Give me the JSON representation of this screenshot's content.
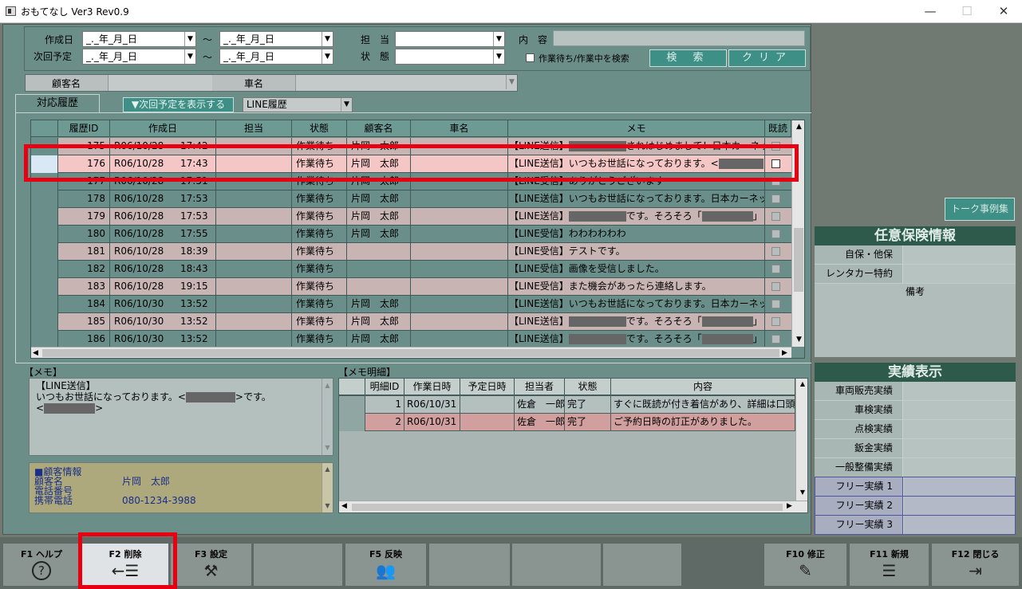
{
  "window": {
    "title": "おもてなし Ver3 Rev0.9",
    "min": "—",
    "max": "☐",
    "close": "✕"
  },
  "search": {
    "created_label": "作成日",
    "next_label": "次回予定",
    "date_placeholder": "_._年_月_日",
    "tilde": "〜",
    "staff_label": "担　当",
    "status_label": "状　態",
    "content_label": "内　容",
    "content_value": "",
    "waiting_checkbox_label": "作業待ち/作業中を検索",
    "search_button": "検 索",
    "clear_button": "クリア",
    "customer_label": "顧客名",
    "car_label": "車名"
  },
  "history": {
    "tab_label": "対応履歴",
    "show_next_button": "▼次回予定を表示する",
    "filter_value": "LINE履歴",
    "columns": [
      "履歴ID",
      "作成日",
      "担当",
      "状態",
      "顧客名",
      "車名",
      "メモ",
      "既読"
    ],
    "rows": [
      {
        "id": "175",
        "date": "R06/10/28",
        "time": "17:42",
        "staff": "",
        "status": "作業待ち",
        "customer": "片岡　太郎",
        "car": "",
        "memo_pre": "【LINE送信】",
        "redacted": true,
        "memo_post": "されはじめまして！日本カーネット株式",
        "style": "pink"
      },
      {
        "id": "176",
        "date": "R06/10/28",
        "time": "17:43",
        "staff": "",
        "status": "作業待ち",
        "customer": "片岡　太郎",
        "car": "",
        "memo_pre": "【LINE送信】いつもお世話になっております。<",
        "redacted": true,
        "memo_post": ">",
        "style": "selected"
      },
      {
        "id": "177",
        "date": "R06/10/28",
        "time": "17:51",
        "staff": "",
        "status": "作業待ち",
        "customer": "片岡　太郎",
        "car": "",
        "memo_pre": "【LINE受信】ありがとうございます",
        "redacted": false,
        "memo_post": "",
        "style": "teal"
      },
      {
        "id": "178",
        "date": "R06/10/28",
        "time": "17:53",
        "staff": "",
        "status": "作業待ち",
        "customer": "片岡　太郎",
        "car": "",
        "memo_pre": "【LINE送信】いつもお世話になっております。日本カーネッ",
        "redacted": false,
        "memo_post": "",
        "style": "teal"
      },
      {
        "id": "179",
        "date": "R06/10/28",
        "time": "17:53",
        "staff": "",
        "status": "作業待ち",
        "customer": "片岡　太郎",
        "car": "",
        "memo_pre": "【LINE送信】",
        "redacted": true,
        "memo_post": "です。そろそろ「",
        "redacted2": true,
        "memo_tail": "」",
        "style": "pink"
      },
      {
        "id": "180",
        "date": "R06/10/28",
        "time": "17:55",
        "staff": "",
        "status": "作業待ち",
        "customer": "片岡　太郎",
        "car": "",
        "memo_pre": "【LINE受信】わわわわわわ",
        "redacted": false,
        "memo_post": "",
        "style": "teal"
      },
      {
        "id": "181",
        "date": "R06/10/28",
        "time": "18:39",
        "staff": "",
        "status": "作業待ち",
        "customer": "",
        "car": "",
        "memo_pre": "【LINE受信】テストです。",
        "redacted": false,
        "memo_post": "",
        "style": "pink"
      },
      {
        "id": "182",
        "date": "R06/10/28",
        "time": "18:43",
        "staff": "",
        "status": "作業待ち",
        "customer": "",
        "car": "",
        "memo_pre": "【LINE受信】画像を受信しました。",
        "redacted": false,
        "memo_post": "",
        "style": "teal"
      },
      {
        "id": "183",
        "date": "R06/10/28",
        "time": "19:15",
        "staff": "",
        "status": "作業待ち",
        "customer": "",
        "car": "",
        "memo_pre": "【LINE受信】また機会があったら連絡します。",
        "redacted": false,
        "memo_post": "",
        "style": "pink"
      },
      {
        "id": "184",
        "date": "R06/10/30",
        "time": "13:52",
        "staff": "",
        "status": "作業待ち",
        "customer": "片岡　太郎",
        "car": "",
        "memo_pre": "【LINE送信】いつもお世話になっております。日本カーネッ",
        "redacted": false,
        "memo_post": "",
        "style": "teal"
      },
      {
        "id": "185",
        "date": "R06/10/30",
        "time": "13:52",
        "staff": "",
        "status": "作業待ち",
        "customer": "片岡　太郎",
        "car": "",
        "memo_pre": "【LINE送信】",
        "redacted": true,
        "memo_post": "です。そろそろ「",
        "redacted2": true,
        "memo_tail": "」",
        "style": "pink"
      },
      {
        "id": "186",
        "date": "R06/10/30",
        "time": "13:52",
        "staff": "",
        "status": "作業待ち",
        "customer": "片岡　太郎",
        "car": "",
        "memo_pre": "【LINE送信】",
        "redacted": true,
        "memo_post": "です。そろそろ「",
        "redacted2": true,
        "memo_tail": "」",
        "style": "teal"
      }
    ]
  },
  "memo": {
    "title": "【メモ】",
    "line1": "【LINE送信】",
    "line2_pre": "いつもお世話になっております。<",
    "line2_post": ">です。",
    "line3_pre": "<",
    "line3_post": ">"
  },
  "customer": {
    "heading": "■顧客情報",
    "name_label": "顧客名",
    "name_value": "片岡　太郎",
    "phone_label": "電話番号",
    "phone_value": "",
    "mobile_label": "携帯電話",
    "mobile_value": "080-1234-3988"
  },
  "detail": {
    "title": "【メモ明細】",
    "columns": [
      "明細ID",
      "作業日時",
      "予定日時",
      "担当者",
      "状態",
      "内容"
    ],
    "rows": [
      {
        "id": "1",
        "work_date": "R06/10/31",
        "plan_date": "",
        "staff": "佐倉　一郎",
        "status": "完了",
        "content": "すぐに既読が付き着信があり、詳細は口頭"
      },
      {
        "id": "2",
        "work_date": "R06/10/31",
        "plan_date": "",
        "staff": "佐倉　一郎",
        "status": "完了",
        "content": "ご予約日時の訂正がありました。"
      }
    ]
  },
  "right": {
    "talk_button": "トーク事例集",
    "insurance_title": "任意保険情報",
    "insurance_rows": [
      "自保・他保",
      "レンタカー特約"
    ],
    "remarks_label": "備考",
    "results_title": "実績表示",
    "results_rows": [
      "車両販売実績",
      "車検実績",
      "点検実績",
      "鈑金実績",
      "一般整備実績"
    ],
    "free_rows": [
      "フリー実績 1",
      "フリー実績 2",
      "フリー実績 3"
    ]
  },
  "fkeys": [
    {
      "label": "F1 ヘルプ",
      "icon": "?"
    },
    {
      "label": "F2 削除",
      "icon": "←☰"
    },
    {
      "label": "F3 設定",
      "icon": "⚒"
    },
    {
      "label": "",
      "icon": ""
    },
    {
      "label": "F5 反映",
      "icon": "👥"
    },
    {
      "label": "",
      "icon": ""
    },
    {
      "label": "",
      "icon": ""
    },
    {
      "label": "",
      "icon": ""
    },
    {
      "label": "F10 修正",
      "icon": "✎"
    },
    {
      "label": "F11 新規",
      "icon": "☰"
    },
    {
      "label": "F12 閉じる",
      "icon": "⇥"
    }
  ],
  "colors": {
    "accent_red": "#e60012",
    "teal_button": "#3e8f85",
    "dark_header": "#2d5a4a"
  }
}
